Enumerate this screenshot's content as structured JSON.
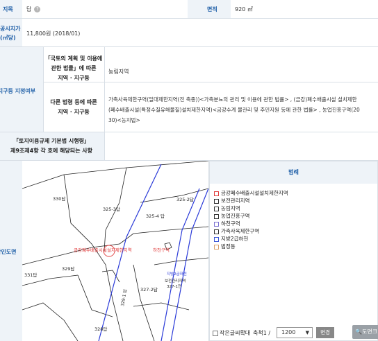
{
  "row1": {
    "label": "지목",
    "value": "답",
    "help_icon": "?",
    "area_label": "면적",
    "area_value": "920 ㎡"
  },
  "row2": {
    "label_line1": "공시지가",
    "label_line2": "(㎡당)",
    "value": "11,800원 (2018/01)"
  },
  "zoning": {
    "label": "지역지구등 지정여부",
    "sub1_line1": "「국토의 계획 및 이용에",
    "sub1_line2": "관한 법률」에 따른",
    "sub1_line3": "지역 · 지구등",
    "sub1_value": "농림지역",
    "sub2_line1": "다른 법령 등에 따른",
    "sub2_line2": "지역 · 지구등",
    "sub2_value_line1": "가축사육제한구역(일대제한지역(전 축종))<가축분뇨의 관리 및 이용에 관한 법률> , (금강)폐수배출시설 설치제한",
    "sub2_value_line2": "(폐수배출시설(특정수질유해물질)설치제한지역)<금강수계 물관리 및 주민지원 등에 관한 법률> , 농업진흥구역(20",
    "sub2_value_line3": "30)<농지법>"
  },
  "enforcement": {
    "line1": "「토지이용규제 기본법 시행령」",
    "line2": "제9조제4항 각 호에 해당되는 사항"
  },
  "map": {
    "label": "확인도면",
    "parcels": [
      "330답",
      "325-3답",
      "325-2답",
      "325-4 답",
      "329답",
      "331답",
      "327-2답",
      "328답"
    ],
    "red_label1": "금강폐수배출시설설치제한지역",
    "red_label2": "하천구역",
    "blue_label": "지방2급하천",
    "black_label1": "보전관리지역",
    "black_label2": "327-1전",
    "vert_label": "329-1 답"
  },
  "legend": {
    "title": "범례",
    "items": [
      {
        "label": "금강폐수배출시설설치제한지역",
        "color": "#e03a3a"
      },
      {
        "label": "보전관리지역",
        "color": "#333333"
      },
      {
        "label": "농림지역",
        "color": "#333333"
      },
      {
        "label": "농업진흥구역",
        "color": "#333333"
      },
      {
        "label": "하천구역",
        "color": "#7a6fd0"
      },
      {
        "label": "가축사육제한구역",
        "color": "#333333"
      },
      {
        "label": "지방2급하천",
        "color": "#3a56d6"
      },
      {
        "label": "법정동",
        "color": "#d9a06a"
      }
    ]
  },
  "controls": {
    "zoom_checkbox_label": "작은글씨확대",
    "scale_label": "축척1 /",
    "scale_value": "1200",
    "change_button": "변경",
    "view_button": "도면크"
  }
}
